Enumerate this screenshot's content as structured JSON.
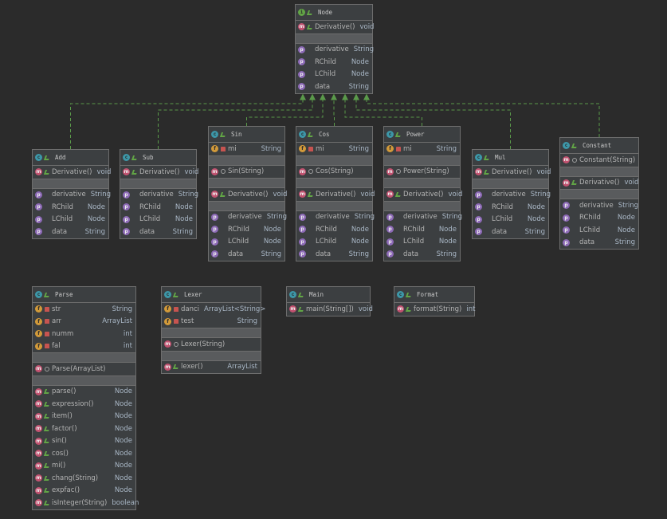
{
  "classes": {
    "node": {
      "title": "Node",
      "kind": "iface",
      "sections": [
        [
          {
            "n": "Derivative()",
            "t": "void",
            "k": "m",
            "v": "pub"
          }
        ],
        [
          {
            "n": "derivative",
            "t": "String",
            "k": "p",
            "v": "none"
          },
          {
            "n": "RChild",
            "t": "Node",
            "k": "p",
            "v": "none"
          },
          {
            "n": "LChild",
            "t": "Node",
            "k": "p",
            "v": "none"
          },
          {
            "n": "data",
            "t": "String",
            "k": "p",
            "v": "none"
          }
        ]
      ]
    },
    "add": {
      "title": "Add",
      "kind": "class",
      "sections": [
        [
          {
            "n": "Derivative()",
            "t": "void",
            "k": "m",
            "v": "pub"
          }
        ],
        [
          {
            "n": "derivative",
            "t": "String",
            "k": "p",
            "v": "none"
          },
          {
            "n": "RChild",
            "t": "Node",
            "k": "p",
            "v": "none"
          },
          {
            "n": "LChild",
            "t": "Node",
            "k": "p",
            "v": "none"
          },
          {
            "n": "data",
            "t": "String",
            "k": "p",
            "v": "none"
          }
        ]
      ]
    },
    "sub": {
      "title": "Sub",
      "kind": "class",
      "sections": [
        [
          {
            "n": "Derivative()",
            "t": "void",
            "k": "m",
            "v": "pub"
          }
        ],
        [
          {
            "n": "derivative",
            "t": "String",
            "k": "p",
            "v": "none"
          },
          {
            "n": "RChild",
            "t": "Node",
            "k": "p",
            "v": "none"
          },
          {
            "n": "LChild",
            "t": "Node",
            "k": "p",
            "v": "none"
          },
          {
            "n": "data",
            "t": "String",
            "k": "p",
            "v": "none"
          }
        ]
      ]
    },
    "sin": {
      "title": "Sin",
      "kind": "class",
      "sections": [
        [
          {
            "n": "mi",
            "t": "String",
            "k": "f",
            "v": "pri"
          }
        ],
        [
          {
            "n": "Sin(String)",
            "t": "",
            "k": "m",
            "v": "dot"
          }
        ],
        [
          {
            "n": "Derivative()",
            "t": "void",
            "k": "m",
            "v": "pub"
          }
        ],
        [
          {
            "n": "derivative",
            "t": "String",
            "k": "p",
            "v": "none"
          },
          {
            "n": "RChild",
            "t": "Node",
            "k": "p",
            "v": "none"
          },
          {
            "n": "LChild",
            "t": "Node",
            "k": "p",
            "v": "none"
          },
          {
            "n": "data",
            "t": "String",
            "k": "p",
            "v": "none"
          }
        ]
      ]
    },
    "cos": {
      "title": "Cos",
      "kind": "class",
      "sections": [
        [
          {
            "n": "mi",
            "t": "String",
            "k": "f",
            "v": "pri"
          }
        ],
        [
          {
            "n": "Cos(String)",
            "t": "",
            "k": "m",
            "v": "dot"
          }
        ],
        [
          {
            "n": "Derivative()",
            "t": "void",
            "k": "m",
            "v": "pub"
          }
        ],
        [
          {
            "n": "derivative",
            "t": "String",
            "k": "p",
            "v": "none"
          },
          {
            "n": "RChild",
            "t": "Node",
            "k": "p",
            "v": "none"
          },
          {
            "n": "LChild",
            "t": "Node",
            "k": "p",
            "v": "none"
          },
          {
            "n": "data",
            "t": "String",
            "k": "p",
            "v": "none"
          }
        ]
      ]
    },
    "power": {
      "title": "Power",
      "kind": "class",
      "sections": [
        [
          {
            "n": "mi",
            "t": "String",
            "k": "f",
            "v": "pri"
          }
        ],
        [
          {
            "n": "Power(String)",
            "t": "",
            "k": "m",
            "v": "dot"
          }
        ],
        [
          {
            "n": "Derivative()",
            "t": "void",
            "k": "m",
            "v": "pub"
          }
        ],
        [
          {
            "n": "derivative",
            "t": "String",
            "k": "p",
            "v": "none"
          },
          {
            "n": "RChild",
            "t": "Node",
            "k": "p",
            "v": "none"
          },
          {
            "n": "LChild",
            "t": "Node",
            "k": "p",
            "v": "none"
          },
          {
            "n": "data",
            "t": "String",
            "k": "p",
            "v": "none"
          }
        ]
      ]
    },
    "mul": {
      "title": "Mul",
      "kind": "class",
      "sections": [
        [
          {
            "n": "Derivative()",
            "t": "void",
            "k": "m",
            "v": "pub"
          }
        ],
        [
          {
            "n": "derivative",
            "t": "String",
            "k": "p",
            "v": "none"
          },
          {
            "n": "RChild",
            "t": "Node",
            "k": "p",
            "v": "none"
          },
          {
            "n": "LChild",
            "t": "Node",
            "k": "p",
            "v": "none"
          },
          {
            "n": "data",
            "t": "String",
            "k": "p",
            "v": "none"
          }
        ]
      ]
    },
    "constant": {
      "title": "Constant",
      "kind": "class",
      "sections": [
        [
          {
            "n": "Constant(String)",
            "t": "",
            "k": "m",
            "v": "dot"
          }
        ],
        [
          {
            "n": "Derivative()",
            "t": "void",
            "k": "m",
            "v": "pub"
          }
        ],
        [
          {
            "n": "derivative",
            "t": "String",
            "k": "p",
            "v": "none"
          },
          {
            "n": "RChild",
            "t": "Node",
            "k": "p",
            "v": "none"
          },
          {
            "n": "LChild",
            "t": "Node",
            "k": "p",
            "v": "none"
          },
          {
            "n": "data",
            "t": "String",
            "k": "p",
            "v": "none"
          }
        ]
      ]
    },
    "parse": {
      "title": "Parse",
      "kind": "class",
      "sections": [
        [
          {
            "n": "str",
            "t": "String",
            "k": "f",
            "v": "pri"
          },
          {
            "n": "arr",
            "t": "ArrayList",
            "k": "f",
            "v": "pri"
          },
          {
            "n": "numm",
            "t": "int",
            "k": "f",
            "v": "pri"
          },
          {
            "n": "fal",
            "t": "int",
            "k": "f",
            "v": "pri"
          }
        ],
        [
          {
            "n": "Parse(ArrayList)",
            "t": "",
            "k": "m",
            "v": "dot"
          }
        ],
        [
          {
            "n": "parse()",
            "t": "Node",
            "k": "m",
            "v": "pub"
          },
          {
            "n": "expression()",
            "t": "Node",
            "k": "m",
            "v": "pub"
          },
          {
            "n": "item()",
            "t": "Node",
            "k": "m",
            "v": "pub"
          },
          {
            "n": "factor()",
            "t": "Node",
            "k": "m",
            "v": "pub"
          },
          {
            "n": "sin()",
            "t": "Node",
            "k": "m",
            "v": "pub"
          },
          {
            "n": "cos()",
            "t": "Node",
            "k": "m",
            "v": "pub"
          },
          {
            "n": "mi()",
            "t": "Node",
            "k": "m",
            "v": "pub"
          },
          {
            "n": "chang(String)",
            "t": "Node",
            "k": "m",
            "v": "pub"
          },
          {
            "n": "expfac()",
            "t": "Node",
            "k": "m",
            "v": "pub"
          },
          {
            "n": "isInteger(String)",
            "t": "boolean",
            "k": "m",
            "v": "pub"
          }
        ]
      ]
    },
    "lexer": {
      "title": "Lexer",
      "kind": "class",
      "sections": [
        [
          {
            "n": "danci",
            "t": "ArrayList<String>",
            "k": "f",
            "v": "pri"
          },
          {
            "n": "test",
            "t": "String",
            "k": "f",
            "v": "pri"
          }
        ],
        [
          {
            "n": "Lexer(String)",
            "t": "",
            "k": "m",
            "v": "dot"
          }
        ],
        [
          {
            "n": "lexer()",
            "t": "ArrayList",
            "k": "m",
            "v": "pub"
          }
        ]
      ]
    },
    "main": {
      "title": "Main",
      "kind": "class",
      "sections": [
        [
          {
            "n": "main(String[])",
            "t": "void",
            "k": "m",
            "v": "pub"
          }
        ]
      ]
    },
    "format": {
      "title": "Format",
      "kind": "class",
      "sections": [
        [
          {
            "n": "format(String)",
            "t": "int",
            "k": "m",
            "v": "pub"
          }
        ]
      ]
    }
  },
  "colors": {
    "edge": "#5a9a4a",
    "border": "#6d6d6d",
    "bg": "#2b2b2b"
  }
}
